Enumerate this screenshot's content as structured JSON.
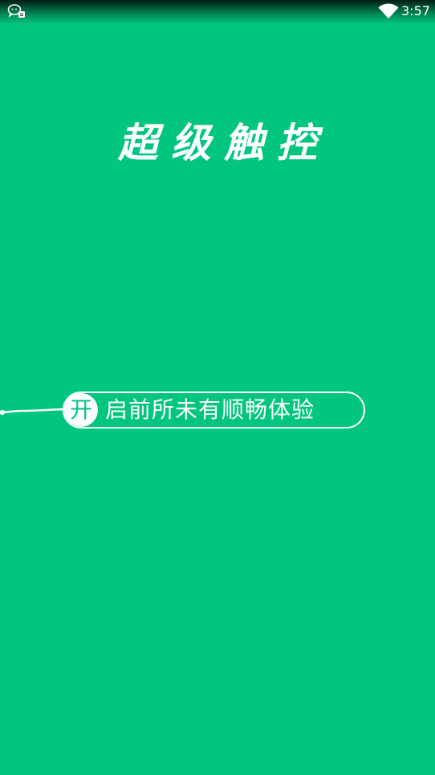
{
  "status_bar": {
    "time": "3:57",
    "left_icon": "chat-notification-icon",
    "right_icon": "wifi-icon"
  },
  "splash": {
    "title": "超级触控",
    "slogan_badge": "开",
    "slogan_text": "启前所未有顺畅体验"
  },
  "colors": {
    "background": "#02c67f",
    "foreground": "#ffffff"
  }
}
